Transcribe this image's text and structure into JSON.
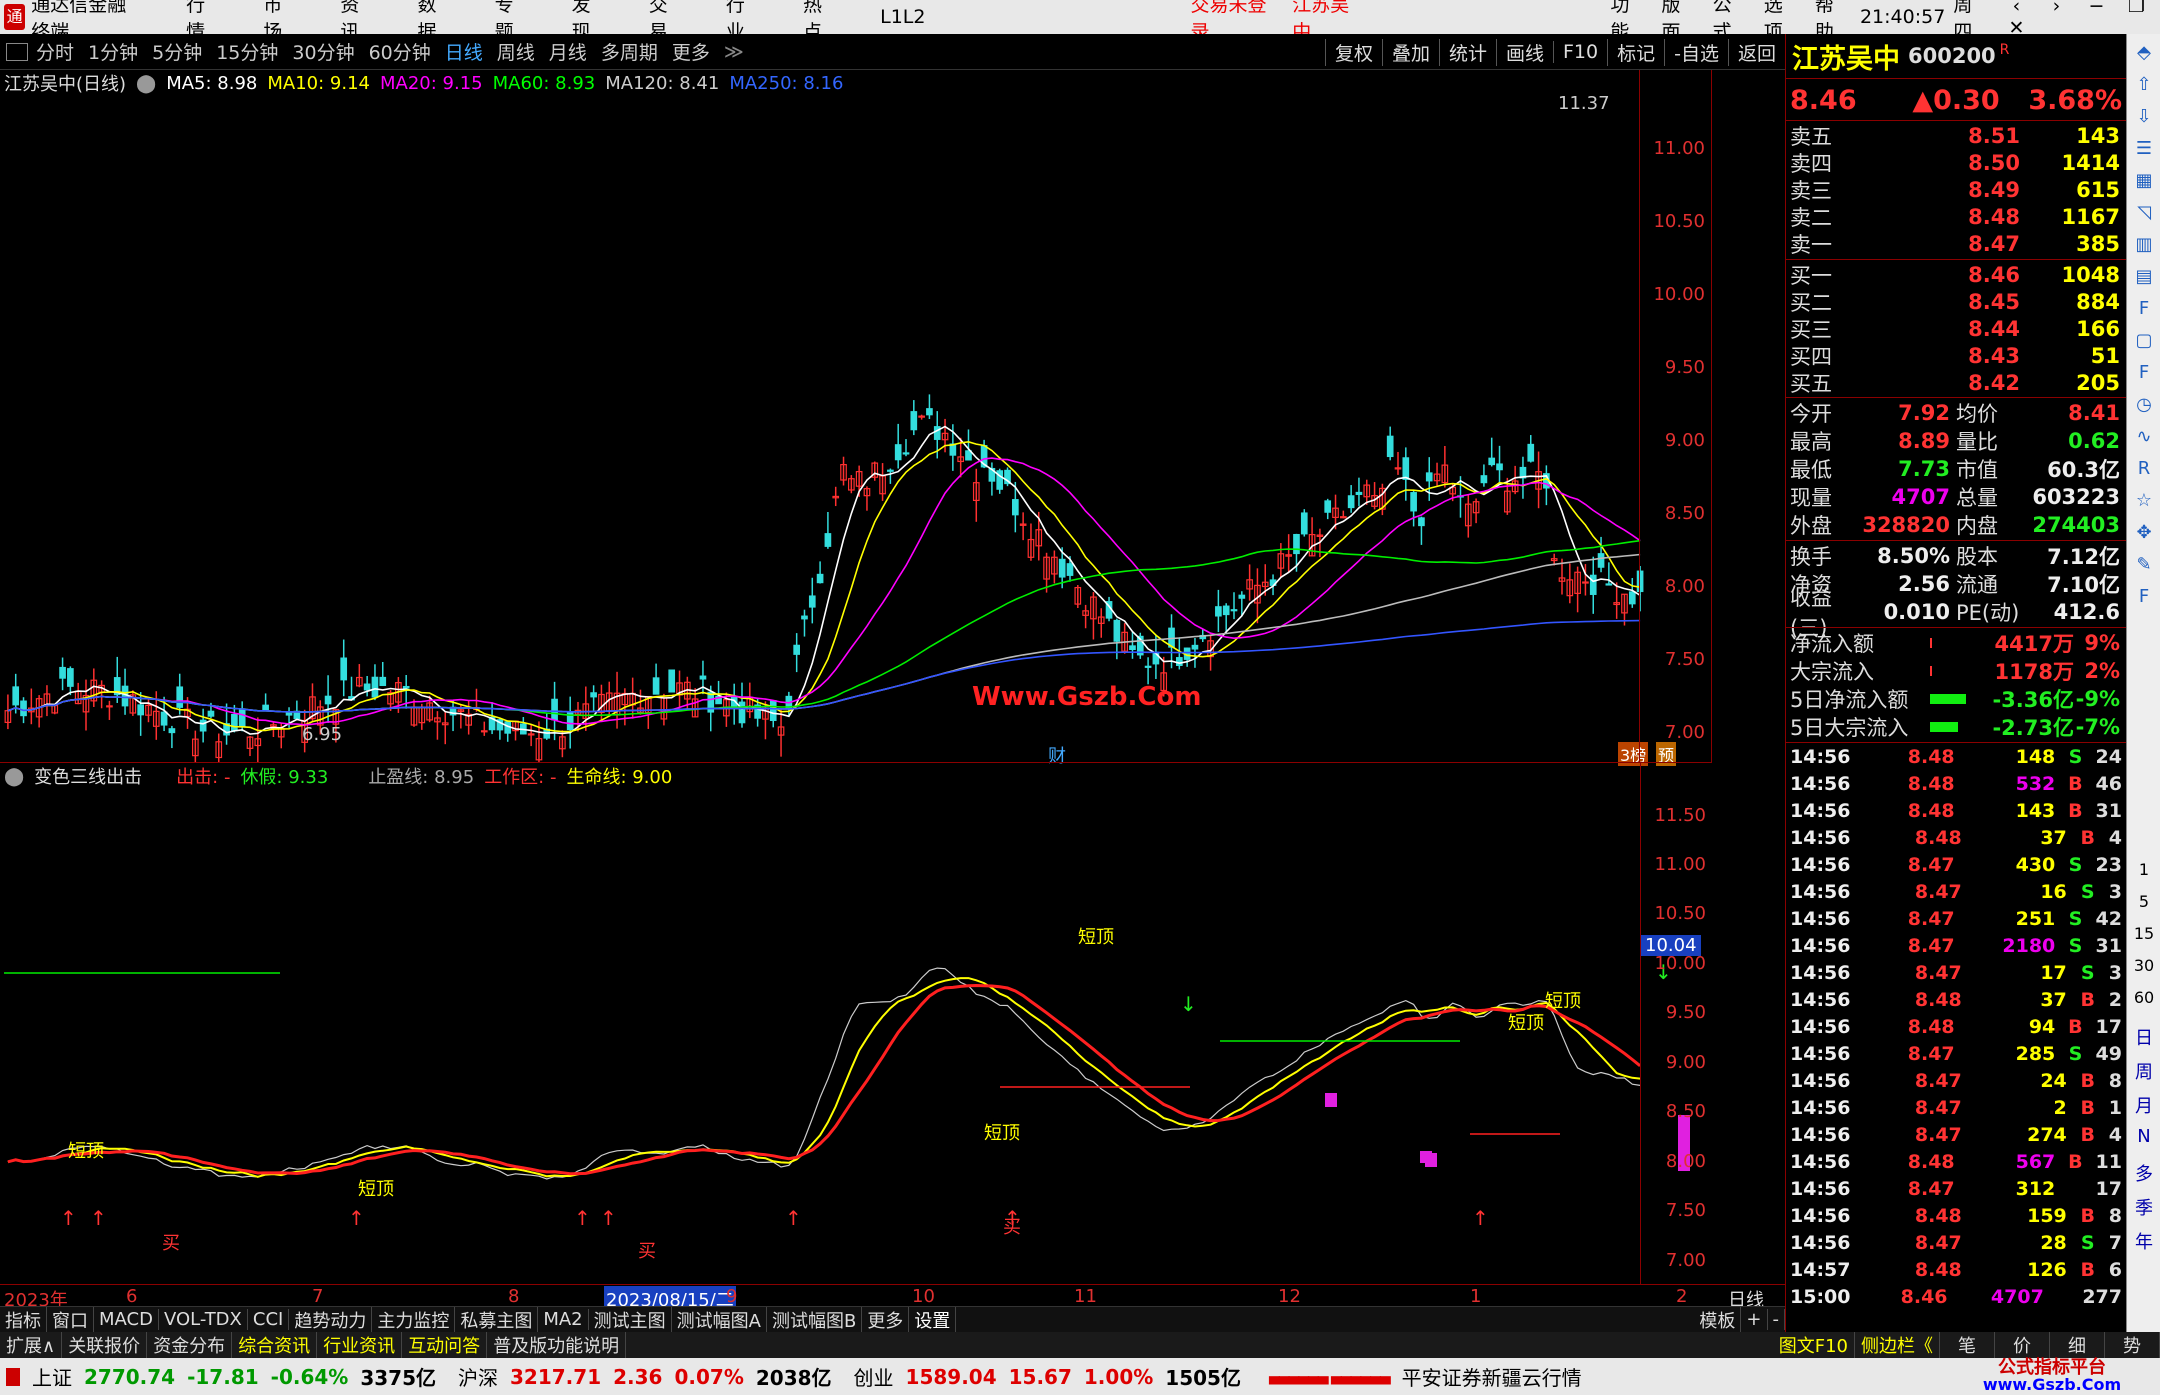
{
  "menubar": {
    "app_title": "通达信金融终端",
    "items": [
      "行情",
      "市场",
      "资讯",
      "数据",
      "专题",
      "发现",
      "交易",
      "行业",
      "热点",
      "L1L2"
    ],
    "trade_status": "交易未登录",
    "stock_tag": "江苏吴中",
    "right_items": [
      "功能",
      "版面",
      "公式",
      "选项",
      "帮助"
    ],
    "clock": "21:40:57",
    "weekday": "周四"
  },
  "periodbar": {
    "periods": [
      "分时",
      "1分钟",
      "5分钟",
      "15分钟",
      "30分钟",
      "60分钟",
      "日线",
      "周线",
      "月线",
      "多周期",
      "更多"
    ],
    "active": "日线",
    "tools": [
      "复权",
      "叠加",
      "统计",
      "画线",
      "F10",
      "标记",
      "-自选",
      "返回"
    ]
  },
  "main_chart": {
    "legend_name": "江苏吴中(日线)",
    "ma": [
      {
        "label": "MA5: 8.98",
        "color": "#ffffff"
      },
      {
        "label": "MA10: 9.14",
        "color": "#ffff00"
      },
      {
        "label": "MA20: 9.15",
        "color": "#ff00ff"
      },
      {
        "label": "MA60: 8.93",
        "color": "#00ff00"
      },
      {
        "label": "MA120: 8.41",
        "color": "#cccccc"
      },
      {
        "label": "MA250: 8.16",
        "color": "#3355ff"
      }
    ],
    "high_label": "11.37",
    "low_label": "6.95",
    "watermark": "Www.Gszb.Com",
    "cai_badge": "财",
    "rank_badge": "3榜",
    "pre_badge": "预",
    "y_ticks": [
      "11.00",
      "10.50",
      "10.00",
      "9.50",
      "9.00",
      "8.50",
      "8.00",
      "7.50",
      "7.00"
    ]
  },
  "indicator": {
    "name": "变色三线出击",
    "out_label": "出击: -",
    "rest_label": "休假: 9.33",
    "stop_label": "止盈线: 8.95",
    "work_label": "工作区: -",
    "life_label": "生命线: 9.00",
    "y_ticks": [
      "11.50",
      "11.00",
      "10.50",
      "10.00",
      "9.50",
      "9.00",
      "8.50",
      "8.00",
      "7.50",
      "7.00"
    ],
    "current_value": "10.04",
    "top_labels": [
      "短顶",
      "短顶",
      "短顶",
      "短顶",
      "短顶",
      "短顶"
    ],
    "buy_labels": [
      "买",
      "买",
      "买"
    ]
  },
  "xaxis": {
    "labels": [
      "2023年",
      "6",
      "7",
      "8",
      "2023/08/15/二",
      "9",
      "10",
      "11",
      "12",
      "1",
      "2"
    ],
    "period_label": "日线"
  },
  "tabs1": [
    "指标",
    "窗口",
    "MACD",
    "VOL-TDX",
    "CCI",
    "趋势动力",
    "主力监控",
    "私募主图",
    "MA2",
    "测试主图",
    "测试幅图A",
    "测试幅图B",
    "更多",
    "设置"
  ],
  "tabs1_right": [
    "模板",
    "+",
    "-"
  ],
  "tabs2": [
    "扩展∧",
    "关联报价",
    "资金分布",
    "综合资讯",
    "行业资讯",
    "互动问答",
    "普及版功能说明"
  ],
  "tabs2_right": [
    "图文F10",
    "侧边栏《",
    "笔",
    "价",
    "细",
    "势"
  ],
  "status": {
    "sh": {
      "name": "上证",
      "value": "2770.74",
      "chg": "-17.81",
      "pct": "-0.64%",
      "amt": "3375亿"
    },
    "hs": {
      "name": "沪深",
      "value": "3217.71",
      "chg": "2.36",
      "pct": "0.07%",
      "amt": "2038亿"
    },
    "cy": {
      "name": "创业",
      "value": "1589.04",
      "chg": "15.67",
      "pct": "1.00%",
      "amt": "1505亿"
    },
    "broker": "平安证券新疆云行情",
    "site_logo": "公式指标平台",
    "site_url": "www.Gszb.Com"
  },
  "quote": {
    "name": "江苏吴中",
    "code": "600200",
    "r_mark": "R",
    "price": "8.46",
    "change": "▲0.30",
    "pct": "3.68%",
    "asks": [
      {
        "label": "卖五",
        "price": "8.51",
        "vol": "143"
      },
      {
        "label": "卖四",
        "price": "8.50",
        "vol": "1414"
      },
      {
        "label": "卖三",
        "price": "8.49",
        "vol": "615"
      },
      {
        "label": "卖二",
        "price": "8.48",
        "vol": "1167"
      },
      {
        "label": "卖一",
        "price": "8.47",
        "vol": "385"
      }
    ],
    "bids": [
      {
        "label": "买一",
        "price": "8.46",
        "vol": "1048"
      },
      {
        "label": "买二",
        "price": "8.45",
        "vol": "884"
      },
      {
        "label": "买三",
        "price": "8.44",
        "vol": "166"
      },
      {
        "label": "买四",
        "price": "8.43",
        "vol": "51"
      },
      {
        "label": "买五",
        "price": "8.42",
        "vol": "205"
      }
    ],
    "stats": [
      {
        "l1": "今开",
        "v1": "7.92",
        "c1": "red",
        "l2": "均价",
        "v2": "8.41",
        "c2": "red"
      },
      {
        "l1": "最高",
        "v1": "8.89",
        "c1": "red",
        "l2": "量比",
        "v2": "0.62",
        "c2": "grn"
      },
      {
        "l1": "最低",
        "v1": "7.73",
        "c1": "grn",
        "l2": "市值",
        "v2": "60.3亿",
        "c2": "wht"
      },
      {
        "l1": "现量",
        "v1": "4707",
        "c1": "mag",
        "l2": "总量",
        "v2": "603223",
        "c2": "wht"
      },
      {
        "l1": "外盘",
        "v1": "328820",
        "c1": "red",
        "l2": "内盘",
        "v2": "274403",
        "c2": "grn"
      }
    ],
    "stats2": [
      {
        "l1": "换手",
        "v1": "8.50%",
        "l2": "股本",
        "v2": "7.12亿"
      },
      {
        "l1": "净资",
        "v1": "2.56",
        "l2": "流通",
        "v2": "7.10亿"
      },
      {
        "l1": "收益(三)",
        "v1": "0.010",
        "l2": "PE(动)",
        "v2": "412.6"
      }
    ],
    "flows": [
      {
        "label": "净流入额",
        "value": "4417万",
        "pct": "9%",
        "color": "red",
        "bar": "0.02"
      },
      {
        "label": "大宗流入",
        "value": "1178万",
        "pct": "2%",
        "color": "red",
        "bar": "0.01"
      },
      {
        "label": "5日净流入额",
        "value": "-3.36亿",
        "pct": "-9%",
        "color": "grn",
        "bar": "0.9"
      },
      {
        "label": "5日大宗流入",
        "value": "-2.73亿",
        "pct": "-7%",
        "color": "grn",
        "bar": "0.7"
      }
    ],
    "ticks": [
      {
        "t": "14:56",
        "p": "8.48",
        "v": "148",
        "bs": "S",
        "n": "24"
      },
      {
        "t": "14:56",
        "p": "8.48",
        "v": "532",
        "bs": "B",
        "n": "46"
      },
      {
        "t": "14:56",
        "p": "8.48",
        "v": "143",
        "bs": "B",
        "n": "31"
      },
      {
        "t": "14:56",
        "p": "8.48",
        "v": "37",
        "bs": "B",
        "n": "4"
      },
      {
        "t": "14:56",
        "p": "8.47",
        "v": "430",
        "bs": "S",
        "n": "23"
      },
      {
        "t": "14:56",
        "p": "8.47",
        "v": "16",
        "bs": "S",
        "n": "3"
      },
      {
        "t": "14:56",
        "p": "8.47",
        "v": "251",
        "bs": "S",
        "n": "42"
      },
      {
        "t": "14:56",
        "p": "8.47",
        "v": "2180",
        "bs": "S",
        "n": "31"
      },
      {
        "t": "14:56",
        "p": "8.47",
        "v": "17",
        "bs": "S",
        "n": "3"
      },
      {
        "t": "14:56",
        "p": "8.48",
        "v": "37",
        "bs": "B",
        "n": "2"
      },
      {
        "t": "14:56",
        "p": "8.48",
        "v": "94",
        "bs": "B",
        "n": "17"
      },
      {
        "t": "14:56",
        "p": "8.47",
        "v": "285",
        "bs": "S",
        "n": "49"
      },
      {
        "t": "14:56",
        "p": "8.47",
        "v": "24",
        "bs": "B",
        "n": "8"
      },
      {
        "t": "14:56",
        "p": "8.47",
        "v": "2",
        "bs": "B",
        "n": "1"
      },
      {
        "t": "14:56",
        "p": "8.47",
        "v": "274",
        "bs": "B",
        "n": "4"
      },
      {
        "t": "14:56",
        "p": "8.48",
        "v": "567",
        "bs": "B",
        "n": "11"
      },
      {
        "t": "14:56",
        "p": "8.47",
        "v": "312",
        "bs": "",
        "n": "17"
      },
      {
        "t": "14:56",
        "p": "8.48",
        "v": "159",
        "bs": "B",
        "n": "8"
      },
      {
        "t": "14:56",
        "p": "8.47",
        "v": "28",
        "bs": "S",
        "n": "7"
      },
      {
        "t": "14:57",
        "p": "8.48",
        "v": "126",
        "bs": "B",
        "n": "6"
      },
      {
        "t": "15:00",
        "p": "8.46",
        "v": "4707",
        "bs": "",
        "n": "277"
      }
    ]
  },
  "rightbar": {
    "labels": [
      "日",
      "周",
      "月",
      "N",
      "多",
      "季",
      "年"
    ],
    "mini_labels": [
      "1",
      "5",
      "15",
      "30",
      "60"
    ],
    "icons": [
      "collapse-icon",
      "up-icon",
      "down-icon",
      "list-icon",
      "grid-icon",
      "chart-icon",
      "bar-icon",
      "table-icon",
      "f10-icon",
      "doc-icon",
      "f-icon",
      "clock-icon",
      "signal-icon",
      "rsi-icon",
      "star-icon",
      "compass-icon",
      "pen-icon",
      "fs-icon"
    ]
  }
}
